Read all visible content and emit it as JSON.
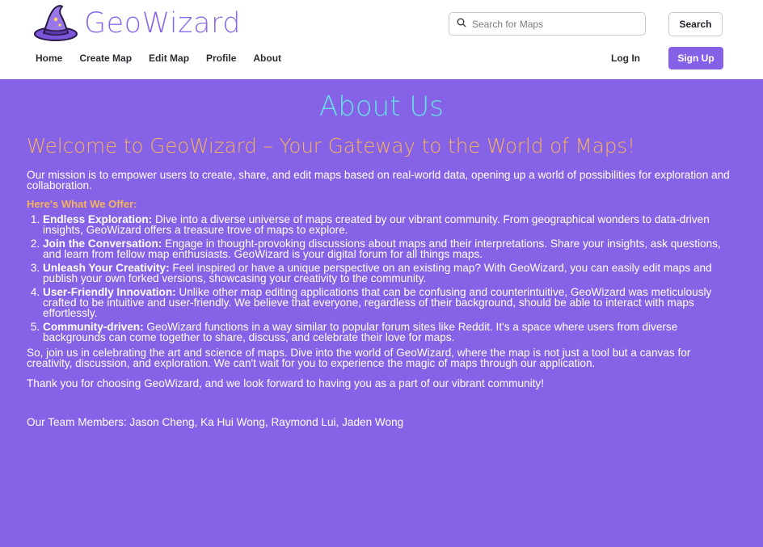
{
  "brand": {
    "name": "GeoWizard"
  },
  "nav": {
    "items": [
      "Home",
      "Create Map",
      "Edit Map",
      "Profile",
      "About"
    ],
    "login": "Log In",
    "signup": "Sign Up"
  },
  "search": {
    "placeholder": "Search for Maps",
    "value": "",
    "button": "Search"
  },
  "colors": {
    "accent": "#8663e6",
    "title": "#67e0e6",
    "highlight": "#f5b25e",
    "logo_hat": "#7d55d9"
  },
  "icons": {
    "logo": "wizard-hat-icon",
    "search": "search-icon"
  },
  "about": {
    "title": "About Us",
    "welcome": "Welcome to GeoWizard – Your Gateway to the World of Maps!",
    "mission": "Our mission is to empower users to create, share, and edit maps based on real-world data, opening up a world of possibilities for exploration and collaboration.",
    "offer_heading": "Here's What We Offer:",
    "offers": [
      {
        "title": "Endless Exploration:",
        "text": " Dive into a diverse universe of maps created by our vibrant community. From geographical wonders to data-driven insights, GeoWizard offers a treasure trove of maps to explore."
      },
      {
        "title": "Join the Conversation:",
        "text": " Engage in thought-provoking discussions about maps and their interpretations. Share your insights, ask questions, and learn from fellow map enthusiasts. GeoWizard is your digital forum for all things maps."
      },
      {
        "title": "Unleash Your Creativity:",
        "text": " Feel inspired or have a unique perspective on an existing map? With GeoWizard, you can easily edit maps and publish your own forked versions, showcasing your creativity to the community."
      },
      {
        "title": "User-Friendly Innovation:",
        "text": " Unlike other map editing applications that can be confusing and counterintuitive, GeoWizard was meticulously crafted to be intuitive and user-friendly. We believe that everyone, regardless of their background, should be able to interact with maps effortlessly."
      },
      {
        "title": "Community-driven:",
        "text": " GeoWizard functions in a way similar to popular forum sites like Reddit. It's a space where users from diverse backgrounds can come together to share, discuss, and celebrate their love for maps."
      }
    ],
    "closing": "So, join us in celebrating the art and science of maps. Dive into the world of GeoWizard, where the map is not just a tool but a canvas for creativity, discussion, and exploration. We can't wait for you to experience the magic of maps through our application.",
    "thanks": "Thank you for choosing GeoWizard, and we look forward to having you as a part of our vibrant community!",
    "team": "Our Team Members: Jason Cheng, Ka Hui Wong, Raymond Lui, Jaden Wong"
  }
}
